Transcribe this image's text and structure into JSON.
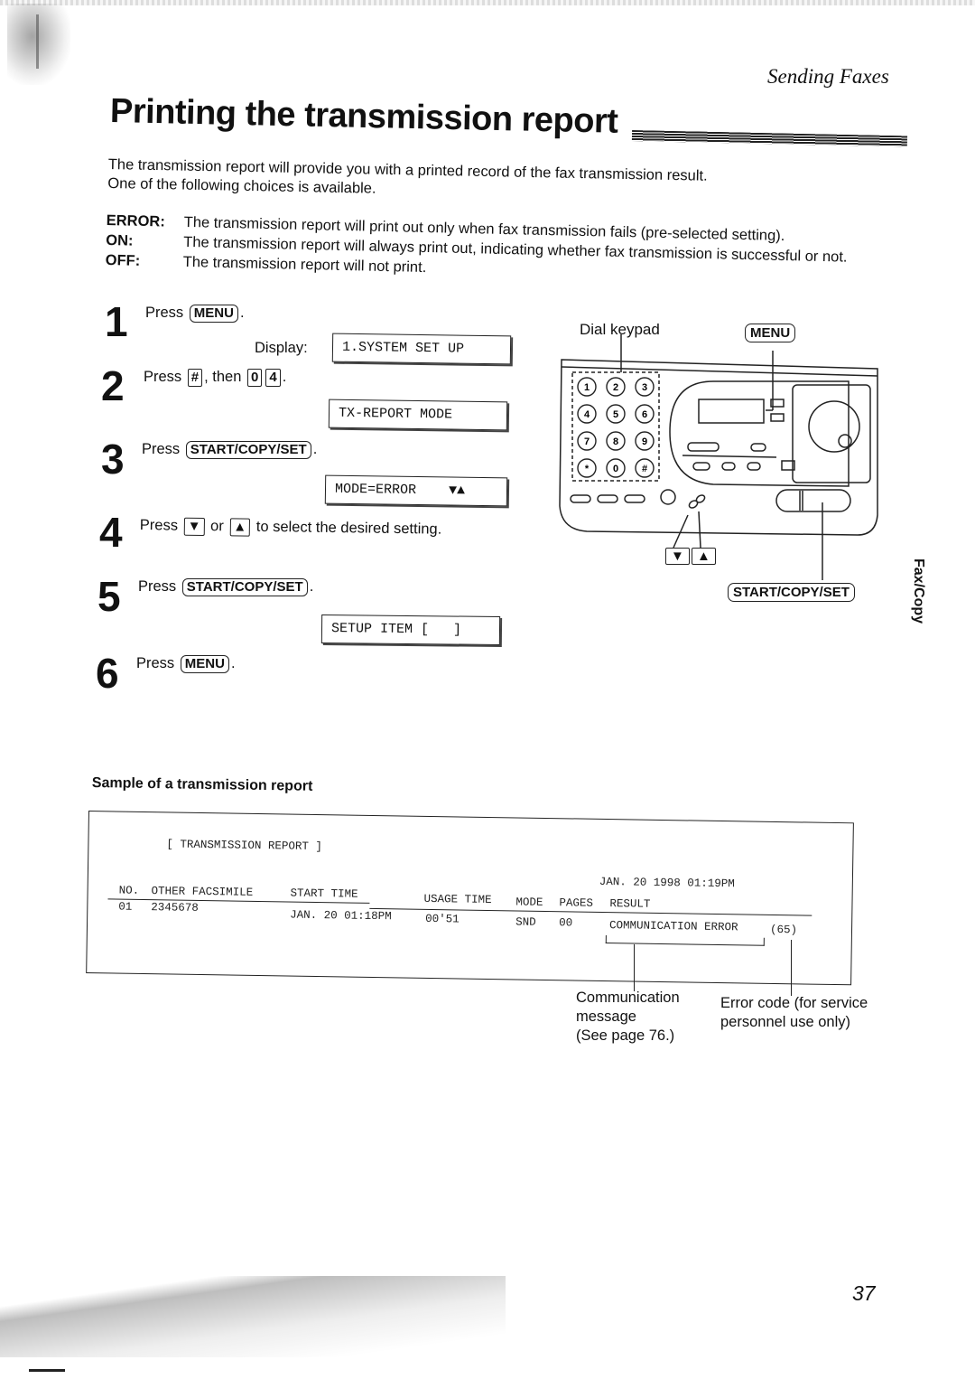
{
  "header": {
    "section_tag": "Sending Faxes",
    "title": "Printing the transmission report"
  },
  "intro": {
    "line1": "The transmission report will provide you with a printed record of the fax transmission result.",
    "line2": "One of the following choices is available."
  },
  "options": [
    {
      "key": "ERROR:",
      "text": "The transmission report will print out only when fax transmission fails (pre-selected setting)."
    },
    {
      "key": "ON:",
      "text": "The transmission report will always print out, indicating whether fax transmission is successful or not."
    },
    {
      "key": "OFF:",
      "text": "The transmission report will not print."
    }
  ],
  "steps": [
    {
      "num": "1",
      "pre": "Press",
      "keys": [
        "MENU"
      ],
      "post": ".",
      "display_label": "Display:",
      "display": "1.SYSTEM SET UP"
    },
    {
      "num": "2",
      "pre": "Press",
      "key1": "#",
      "mid": ", then",
      "key2": "0",
      "key3": "4",
      "post": ".",
      "display": "TX-REPORT MODE"
    },
    {
      "num": "3",
      "pre": "Press",
      "keys": [
        "START/COPY/SET"
      ],
      "post": ".",
      "display": "MODE=ERROR    ▼▲"
    },
    {
      "num": "4",
      "pre": "Press",
      "key1": "▼",
      "mid": "or",
      "key2": "▲",
      "post": "to select the desired setting."
    },
    {
      "num": "5",
      "pre": "Press",
      "keys": [
        "START/COPY/SET"
      ],
      "post": ".",
      "display": "SETUP ITEM [   ]"
    },
    {
      "num": "6",
      "pre": "Press",
      "keys": [
        "MENU"
      ],
      "post": "."
    }
  ],
  "diagram": {
    "dial_keypad_label": "Dial keypad",
    "menu_label": "MENU",
    "start_label": "START/COPY/SET",
    "down_label": "▼",
    "up_label": "▲",
    "keypad_keys": [
      "1",
      "2",
      "3",
      "4",
      "5",
      "6",
      "7",
      "8",
      "9",
      "*",
      "0",
      "#"
    ]
  },
  "side_tab": "Fax/Copy",
  "sample": {
    "title": "Sample of a transmission report",
    "report_title": "[ TRANSMISSION REPORT ]",
    "timestamp": "JAN. 20 1998 01:19PM",
    "columns": [
      "NO.",
      "OTHER FACSIMILE",
      "START TIME",
      "USAGE TIME",
      "MODE",
      "PAGES",
      "RESULT"
    ],
    "row": {
      "no": "01",
      "other_facsimile": "2345678",
      "start_time": "JAN. 20 01:18PM",
      "usage_time": "00'51",
      "mode": "SND",
      "pages": "00",
      "result": "COMMUNICATION ERROR",
      "code": "(65)"
    },
    "callouts": {
      "communication": [
        "Communication",
        "message",
        "(See page 76.)"
      ],
      "error_code": [
        "Error code (for service",
        "personnel use only)"
      ]
    }
  },
  "page_number": "37"
}
